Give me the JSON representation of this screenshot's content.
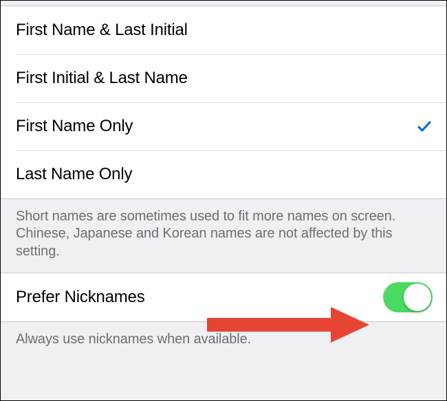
{
  "options": [
    {
      "label": "First Name & Last Initial",
      "selected": false
    },
    {
      "label": "First Initial & Last Name",
      "selected": false
    },
    {
      "label": "First Name Only",
      "selected": true
    },
    {
      "label": "Last Name Only",
      "selected": false
    }
  ],
  "options_footer": "Short names are sometimes used to fit more names on screen. Chinese, Japanese and Korean names are not affected by this setting.",
  "nicknames": {
    "label": "Prefer Nicknames",
    "enabled": true
  },
  "nicknames_footer": "Always use nicknames when available.",
  "colors": {
    "accent_check": "#0563da",
    "toggle_on": "#4cd964",
    "annotation_arrow": "#e64534"
  }
}
